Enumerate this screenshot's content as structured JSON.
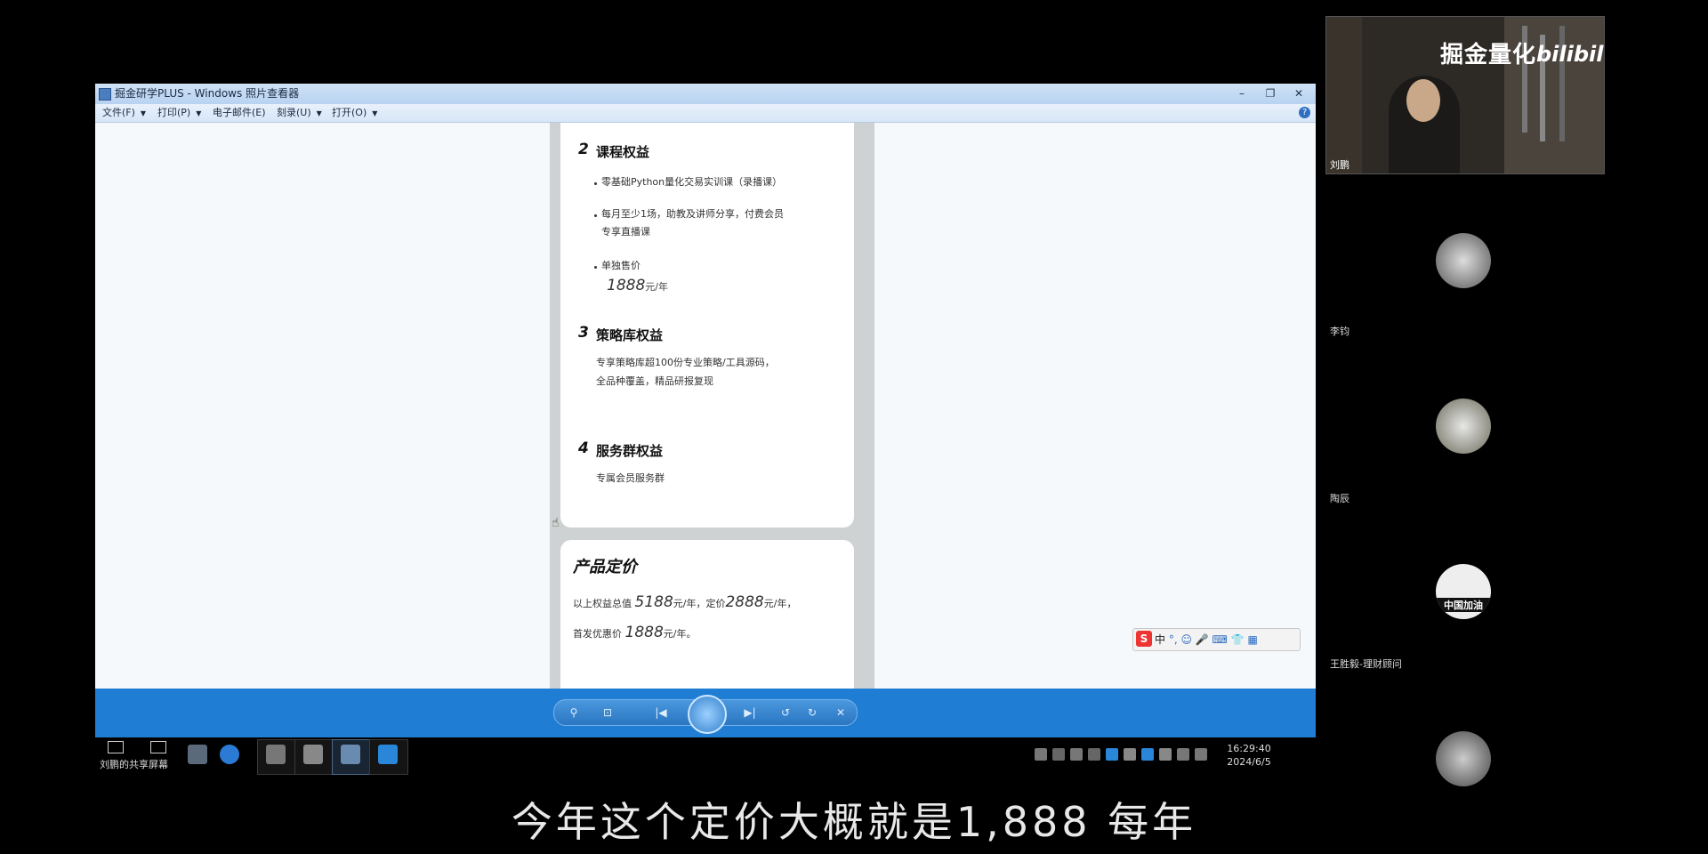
{
  "window": {
    "title": "掘金研学PLUS - Windows 照片查看器",
    "controls": {
      "minimize": "–",
      "maximize": "❐",
      "close": "✕"
    }
  },
  "menu": {
    "file": "文件(F)",
    "print": "打印(P)",
    "email": "电子邮件(E)",
    "burn": "刻录(U)",
    "open": "打开(O)",
    "help": "?"
  },
  "poster": {
    "s2": {
      "num": "2",
      "title": "课程权益",
      "b1": "零基础Python量化交易实训课（录播课）",
      "b2_l1": "每月至少1场，助教及讲师分享，付费会员",
      "b2_l2": "专享直播课",
      "b3": "单独售价",
      "price": "1888",
      "unit": "元/年"
    },
    "s3": {
      "num": "3",
      "title": "策略库权益",
      "l1": "专享策略库超100份专业策略/工具源码，",
      "l2": "全品种覆盖，精品研报复现"
    },
    "s4": {
      "num": "4",
      "title": "服务群权益",
      "l1": "专属会员服务群"
    },
    "pricing": {
      "title": "产品定价",
      "l1_pre": "以上权益总值",
      "total": "5188",
      "l1_mid": "元/年，定价",
      "list": "2888",
      "l1_end": "元/年，",
      "l2_pre": "首发优惠价",
      "promo": "1888",
      "l2_end": "元/年。"
    }
  },
  "ime": {
    "label": "中",
    "items": "°, ☺ 🎤 ⌨ 👕 ▦"
  },
  "toolbar": {
    "zoom": "⚲",
    "fit": "⊡",
    "prev": "|◀",
    "next": "▶|",
    "rotl": "↺",
    "rotr": "↻",
    "del": "✕"
  },
  "taskbar": {
    "share_label": "刘鹏的共享屏幕",
    "time": "16:29:40",
    "date": "2024/6/5"
  },
  "camera": {
    "watermark": "掘金量化",
    "logo": "bilibili",
    "name": "刘鹏"
  },
  "participants": [
    {
      "name": "李钧"
    },
    {
      "name": "陶辰"
    },
    {
      "name": "王胜毅-理财顾问",
      "badge": "中国加油"
    },
    {
      "name": ""
    }
  ],
  "subtitle": "今年这个定价大概就是1,888 每年",
  "colors": {
    "toolbar": "#1f7ed4",
    "background": "#000000",
    "poster": "#cfd2d2"
  }
}
